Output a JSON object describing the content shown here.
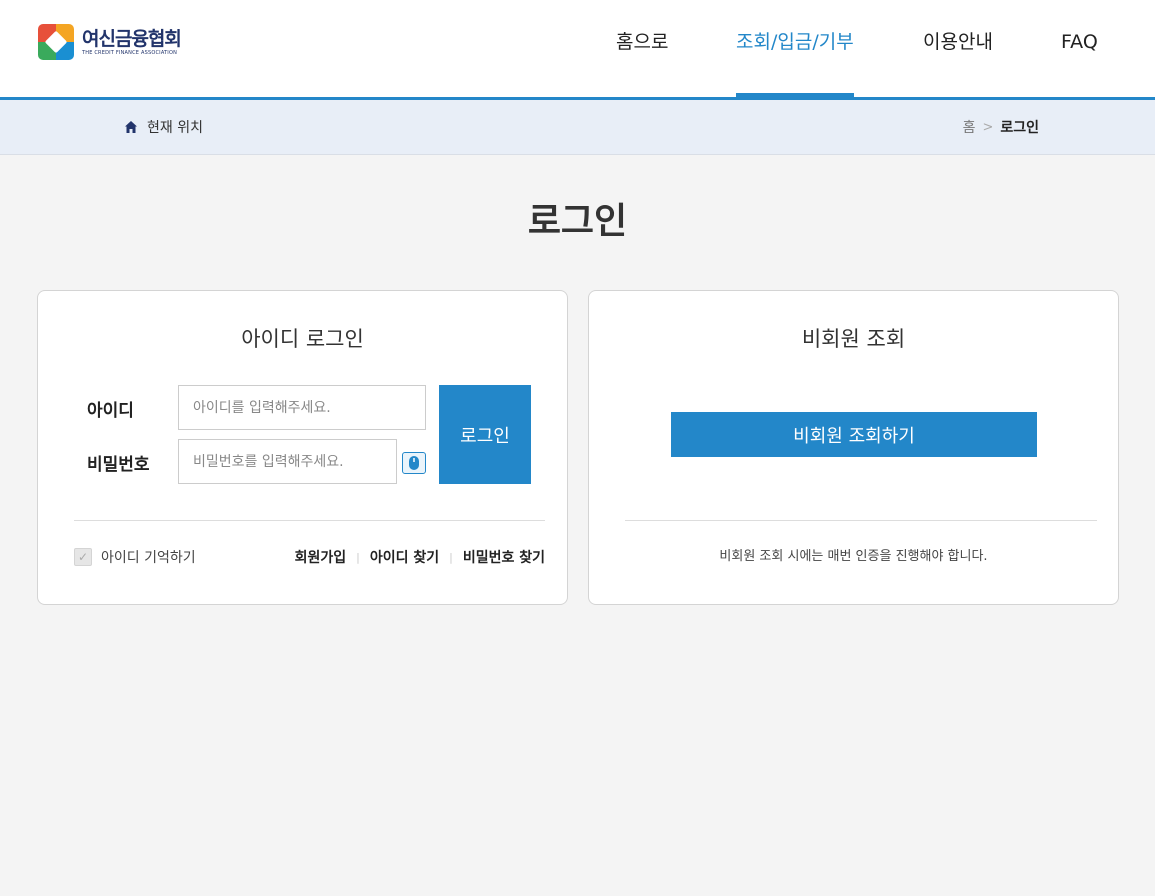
{
  "header": {
    "logo_ko": "여신금융협회",
    "logo_en": "THE CREDIT FINANCE ASSOCIATION",
    "nav": [
      {
        "label": "홈으로",
        "active": false
      },
      {
        "label": "조회/입금/기부",
        "active": true
      },
      {
        "label": "이용안내",
        "active": false
      },
      {
        "label": "FAQ",
        "active": false
      }
    ]
  },
  "breadcrumb": {
    "location_label": "현재 위치",
    "home": "홈",
    "separator": ">",
    "current": "로그인"
  },
  "page_title": "로그인",
  "id_login": {
    "title": "아이디 로그인",
    "id_label": "아이디",
    "id_placeholder": "아이디를 입력해주세요.",
    "pw_label": "비밀번호",
    "pw_placeholder": "비밀번호를 입력해주세요.",
    "login_button": "로그인",
    "remember_label": "아이디 기억하기",
    "links": {
      "signup": "회원가입",
      "find_id": "아이디 찾기",
      "find_pw": "비밀번호 찾기"
    }
  },
  "guest": {
    "title": "비회원 조회",
    "button": "비회원 조회하기",
    "note": "비회원 조회 시에는 매번 인증을 진행해야 합니다."
  },
  "colors": {
    "accent": "#2387c9",
    "crumb_bg": "#e8eef7",
    "page_bg": "#f4f4f4"
  }
}
